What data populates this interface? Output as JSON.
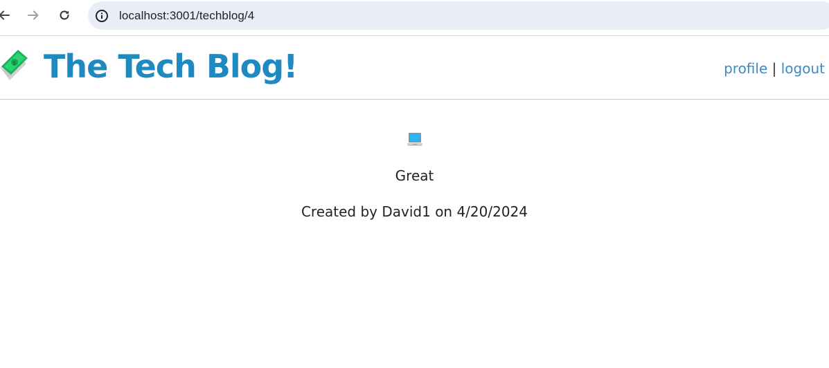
{
  "browser": {
    "url": "localhost:3001/techblog/4"
  },
  "header": {
    "title": "The Tech Blog!",
    "logo_icon": "money-with-wings-icon",
    "nav": {
      "profile_label": "profile",
      "separator": "|",
      "logout_label": "logout"
    }
  },
  "post": {
    "icon": "laptop-icon",
    "content": "Great",
    "meta": "Created by David1 on 4/20/2024"
  },
  "colors": {
    "title": "#1f89c0",
    "link": "#3b8ac4",
    "omnibox_bg": "#e9edf6"
  }
}
